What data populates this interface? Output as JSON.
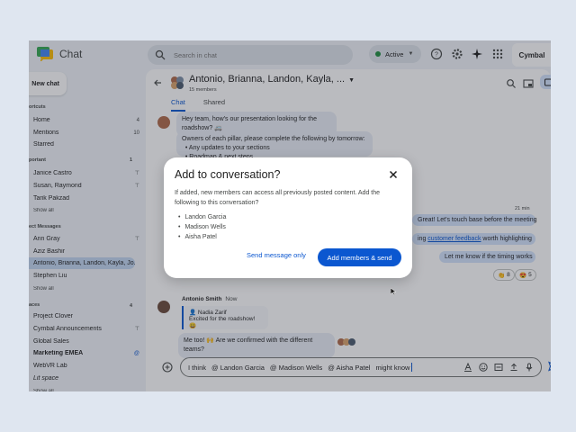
{
  "app": {
    "title": "Chat",
    "brand": "Cymbal"
  },
  "search": {
    "placeholder": "Search in chat"
  },
  "status": {
    "label": "Active"
  },
  "sidebar": {
    "new_chat": "New chat",
    "shortcuts_label": "ortcuts",
    "shortcuts": [
      {
        "label": "Home",
        "count": "4"
      },
      {
        "label": "Mentions",
        "count": "10"
      },
      {
        "label": "Starred",
        "count": ""
      }
    ],
    "important_label": "portant",
    "important_count": "1",
    "important": [
      {
        "label": "Janice Castro",
        "count": ""
      },
      {
        "label": "Susan, Raymond",
        "count": ""
      },
      {
        "label": "Tarik Pakzad",
        "count": ""
      }
    ],
    "show_all": "Show all",
    "dm_label": "ect Messages",
    "dms": [
      {
        "label": "Ann Gray"
      },
      {
        "label": "Aziz Bashir"
      },
      {
        "label": "Antonio, Brianna, Landon, Kayla, Jo..."
      },
      {
        "label": "Stephen Liu"
      }
    ],
    "spaces_label": "aces",
    "spaces_count": "4",
    "spaces": [
      {
        "label": "Project Clover"
      },
      {
        "label": "Cymbal Announcements"
      },
      {
        "label": "Global Sales"
      },
      {
        "label": "Marketing EMEA"
      },
      {
        "label": "WebVR Lab"
      },
      {
        "label": "Lit space"
      }
    ]
  },
  "conversation": {
    "title": "Antonio, Brianna, Landon, Kayla, ...",
    "members": "15 members",
    "tabs": [
      "Chat",
      "Shared"
    ],
    "msg1": "Hey team, how's our presentation looking for the roadshow? 🚐",
    "msg2_intro": "Owners of each pillar, please complete the following by tomorrow:",
    "msg2_items": [
      "Any updates to your sections",
      "Roadmap & next steps"
    ],
    "time_label": "21 min",
    "mine1": "Great! Let's touch base before the meeting",
    "mine2_pre": "ing",
    "mine2_link": "customer feedback",
    "mine2_post": "worth highlighting",
    "mine3": "Let me know if the timing works",
    "reactions": [
      {
        "emoji": "👏",
        "count": "8"
      },
      {
        "emoji": "😍",
        "count": "5"
      }
    ],
    "sender": "Antonio Smith",
    "sender_time": "Now",
    "quote_author": "Nadia Zarif",
    "quote_text": "Excited for the roadshow! 😀",
    "reply": "Me too! 🙌 Are we confirmed with the different teams?"
  },
  "composer": {
    "prefix": "I think",
    "mentions": [
      "@ Landon Garcia",
      "@ Madison Wells",
      "@ Aisha Patel"
    ],
    "suffix": "might know"
  },
  "dialog": {
    "title": "Add to conversation?",
    "body": "If added, new members can access all previously posted content. Add the following to this conversation?",
    "people": [
      "Landon Garcia",
      "Madison Wells",
      "Aisha Patel"
    ],
    "secondary": "Send message only",
    "primary": "Add members & send"
  },
  "colors": {
    "accent": "#0b57d0",
    "surface": "#f0f4f9",
    "active": "#1e8e3e"
  }
}
